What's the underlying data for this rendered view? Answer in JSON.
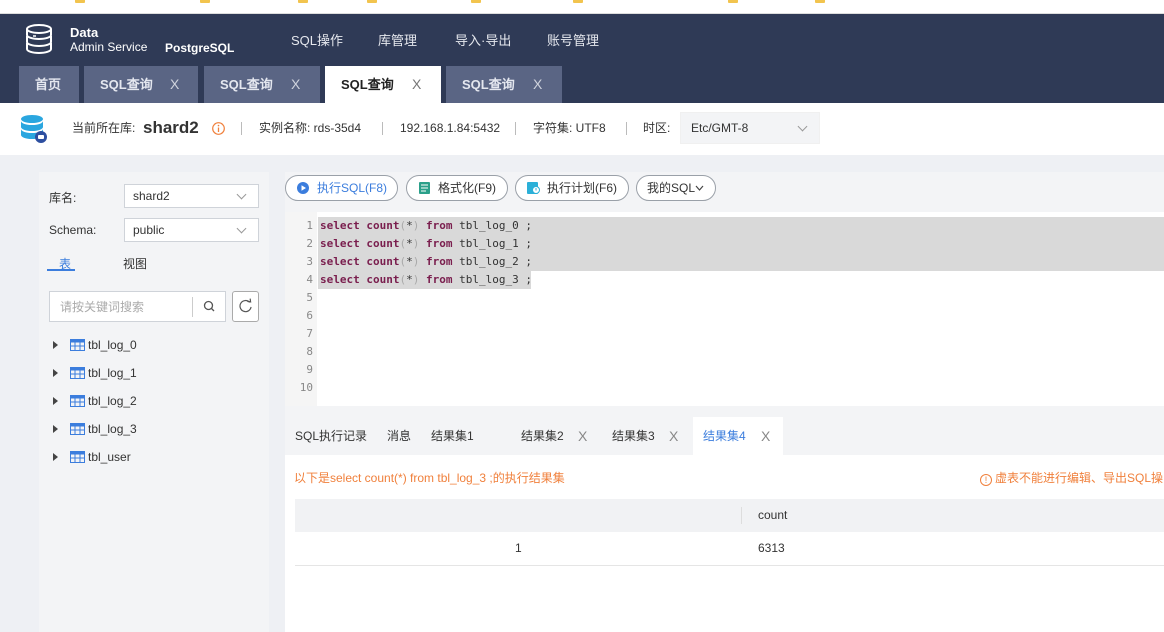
{
  "app": {
    "logo_line1": "Data",
    "logo_line2": "Admin Service",
    "engine": "PostgreSQL"
  },
  "nav": [
    "SQL操作",
    "库管理",
    "导入·导出",
    "账号管理"
  ],
  "tabs": [
    {
      "label": "首页",
      "closable": false
    },
    {
      "label": "SQL查询",
      "closable": true
    },
    {
      "label": "SQL查询",
      "closable": true
    },
    {
      "label": "SQL查询",
      "closable": true,
      "active": true
    },
    {
      "label": "SQL查询",
      "closable": true
    }
  ],
  "close_glyph": "X",
  "info": {
    "db_label": "当前所在库:",
    "db_name": "shard2",
    "instance": "实例名称: rds-35d4",
    "address": "192.168.1.84:5432",
    "charset": "字符集: UTF8",
    "tz_label": "时区:",
    "tz_value": "Etc/GMT-8"
  },
  "sidebar": {
    "db_label": "库名:",
    "db_value": "shard2",
    "schema_label": "Schema:",
    "schema_value": "public",
    "tab_tables": "表",
    "tab_views": "视图",
    "search_placeholder": "请按关键词搜索",
    "tables": [
      "tbl_log_0",
      "tbl_log_1",
      "tbl_log_2",
      "tbl_log_3",
      "tbl_user"
    ]
  },
  "toolbar": {
    "run": "执行SQL(F8)",
    "format": "格式化(F9)",
    "plan": "执行计划(F6)",
    "my_sql": "我的SQL"
  },
  "editor": {
    "line_count": 10,
    "lines": [
      "select count(*) from tbl_log_0 ;",
      "select count(*) from tbl_log_1 ;",
      "select count(*) from tbl_log_2 ;",
      "select count(*) from tbl_log_3 ;"
    ]
  },
  "result_tabs": [
    {
      "label": "SQL执行记录",
      "closable": false
    },
    {
      "label": "消息",
      "closable": false
    },
    {
      "label": "结果集1",
      "closable": false
    },
    {
      "label": "结果集2",
      "closable": true
    },
    {
      "label": "结果集3",
      "closable": true
    },
    {
      "label": "结果集4",
      "closable": true,
      "active": true
    }
  ],
  "result": {
    "message": "以下是select count(*) from tbl_log_3 ;的执行结果集",
    "warning": "虚表不能进行编辑、导出SQL操",
    "columns": [
      "",
      "count"
    ],
    "rows": [
      [
        "1",
        "6313"
      ]
    ]
  },
  "colors": {
    "nav_bg": "#2f3a56",
    "tab_inactive": "#5a6584",
    "accent": "#3b7ddd",
    "warn": "#f0803c",
    "keyword": "#7a1e4e"
  }
}
